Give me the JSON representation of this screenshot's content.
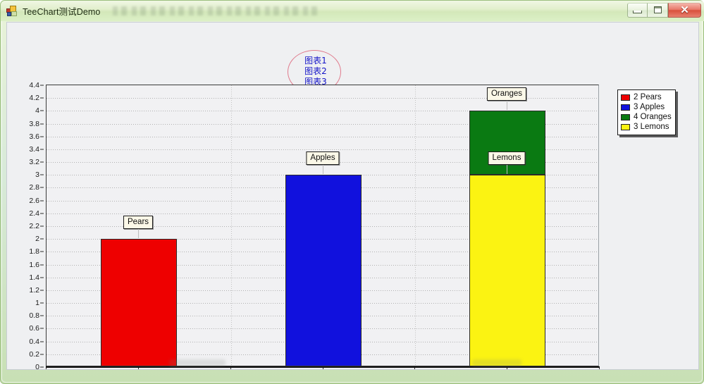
{
  "window": {
    "title": "TeeChart测试Demo",
    "icon": "app-chart-icon",
    "controls": {
      "minimize_label": "–",
      "maximize_label": "□",
      "close_label": "✕"
    }
  },
  "annotation": {
    "lines": [
      "图表1",
      "图表2",
      "图表3"
    ],
    "shape": "ellipse",
    "border_color": "#e07a8c",
    "text_color": "#1515c8"
  },
  "legend": {
    "items": [
      {
        "label": "2 Pears",
        "color": "#ee0000"
      },
      {
        "label": "3 Apples",
        "color": "#1111dd"
      },
      {
        "label": "4 Oranges",
        "color": "#0a7a12"
      },
      {
        "label": "3 Lemons",
        "color": "#fbf312"
      }
    ]
  },
  "marks": [
    {
      "text": "Pears"
    },
    {
      "text": "Apples"
    },
    {
      "text": "Oranges"
    },
    {
      "text": "Lemons"
    }
  ],
  "chart_data": {
    "type": "bar",
    "title": "",
    "xlabel": "",
    "ylabel": "",
    "categories": [
      "Pears",
      "Apples",
      "Oranges"
    ],
    "ylim": [
      0,
      4.4
    ],
    "ytick_step": 0.2,
    "yticks": [
      "4.4",
      "4.2",
      "4",
      "3.8",
      "3.6",
      "3.4",
      "3.2",
      "3",
      "2.8",
      "2.6",
      "2.4",
      "2.2",
      "2",
      "1.8",
      "1.6",
      "1.4",
      "1.2",
      "1",
      "0.8",
      "0.6",
      "0.4",
      "0.2",
      "0"
    ],
    "grid": true,
    "legend_position": "top-right",
    "stacked_last_category": true,
    "series": [
      {
        "name": "Pears",
        "color": "#ee0000",
        "values": [
          2,
          null,
          null
        ],
        "base": [
          0,
          null,
          null
        ]
      },
      {
        "name": "Apples",
        "color": "#1111dd",
        "values": [
          null,
          3,
          null
        ],
        "base": [
          null,
          0,
          null
        ]
      },
      {
        "name": "Lemons",
        "color": "#fbf312",
        "values": [
          null,
          null,
          3
        ],
        "base": [
          null,
          null,
          0
        ]
      },
      {
        "name": "Oranges",
        "color": "#0a7a12",
        "values": [
          null,
          null,
          4
        ],
        "base": [
          null,
          null,
          3
        ]
      }
    ],
    "bars": [
      {
        "category": "Pears",
        "value": 2,
        "base": 0,
        "color": "#ee0000",
        "mark": "Pears"
      },
      {
        "category": "Apples",
        "value": 3,
        "base": 0,
        "color": "#1111dd",
        "mark": "Apples"
      },
      {
        "category": "Oranges",
        "value": 3,
        "base": 0,
        "color": "#fbf312",
        "mark": "Lemons"
      },
      {
        "category": "Oranges",
        "value": 4,
        "base": 3,
        "color": "#0a7a12",
        "mark": "Oranges"
      }
    ]
  }
}
